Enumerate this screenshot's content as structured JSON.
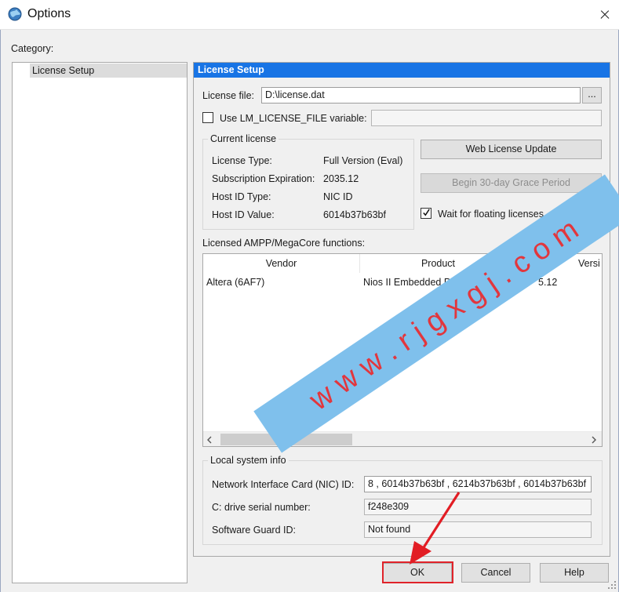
{
  "window": {
    "title": "Options"
  },
  "category": {
    "label": "Category:",
    "items": [
      "License Setup"
    ]
  },
  "panel": {
    "header": "License Setup",
    "license_file_label": "License file:",
    "license_file_value": "D:\\license.dat",
    "browse_label": "...",
    "use_env_label": "Use LM_LICENSE_FILE variable:",
    "use_env_checked": false,
    "env_value": "",
    "current_license": {
      "title": "Current license",
      "rows": [
        {
          "label": "License Type:",
          "value": "Full Version (Eval)"
        },
        {
          "label": "Subscription Expiration:",
          "value": "2035.12"
        },
        {
          "label": "Host ID Type:",
          "value": "NIC ID"
        },
        {
          "label": "Host ID Value:",
          "value": "6014b37b63bf"
        }
      ]
    },
    "web_update_label": "Web License Update",
    "grace_label": "Begin 30-day Grace Period",
    "wait_floating_label": "Wait for floating licenses",
    "wait_floating_checked": true,
    "functions_label": "Licensed AMPP/MegaCore functions:",
    "table": {
      "columns": [
        "Vendor",
        "Product",
        "Versi"
      ],
      "rows": [
        [
          "Altera (6AF7)",
          "Nios II Embedded Proce",
          "5.12"
        ]
      ]
    },
    "local_system": {
      "title": "Local system info",
      "nic_label": "Network Interface Card (NIC) ID:",
      "nic_value": "8 , 6014b37b63bf , 6214b37b63bf , 6014b37b63bf",
      "drive_label": "C: drive serial number:",
      "drive_value": "f248e309",
      "guard_label": "Software Guard ID:",
      "guard_value": "Not found"
    }
  },
  "buttons": {
    "ok": "OK",
    "cancel": "Cancel",
    "help": "Help"
  },
  "watermark": "w w w . r j g x g j . c o m",
  "colors": {
    "header_blue": "#1874e5",
    "highlight_red": "#e0232a",
    "watermark_blue": "#7fc0ec"
  }
}
